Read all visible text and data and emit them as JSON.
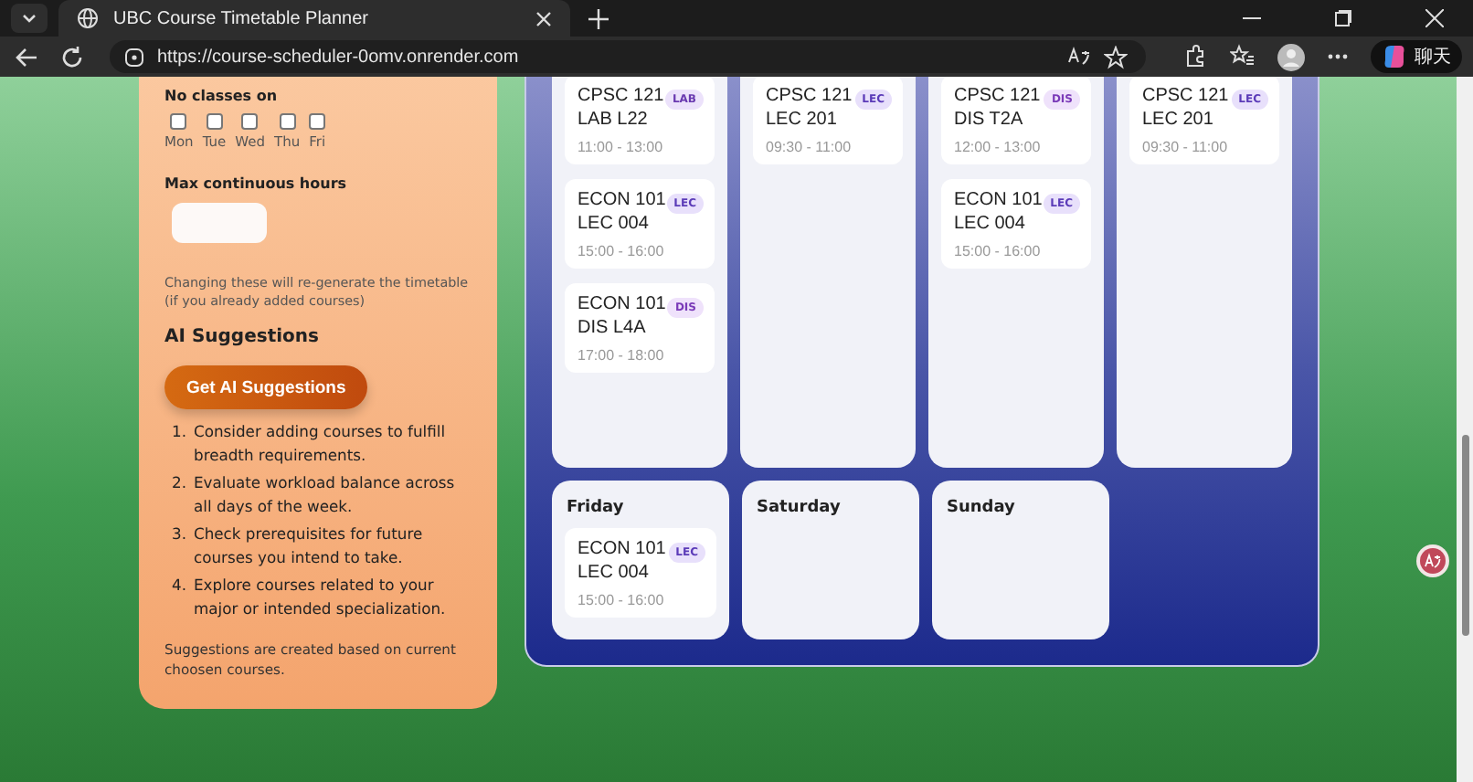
{
  "browser": {
    "tab_title": "UBC Course Timetable Planner",
    "url": "https://course-scheduler-0omv.onrender.com",
    "copilot_label": "聊天"
  },
  "preferences": {
    "no_classes_label": "No classes on",
    "days": [
      {
        "label": "Mon",
        "checked": false
      },
      {
        "label": "Tue",
        "checked": false
      },
      {
        "label": "Wed",
        "checked": false
      },
      {
        "label": "Thu",
        "checked": false
      },
      {
        "label": "Fri",
        "checked": false
      }
    ],
    "max_hours_label": "Max continuous hours",
    "note": "Changing these will re-generate the timetable (if you already added courses)"
  },
  "ai": {
    "title": "AI Suggestions",
    "button": "Get AI Suggestions",
    "suggestions": [
      {
        "number": "1.",
        "text": "Consider adding courses to fulfill breadth requirements."
      },
      {
        "number": "2.",
        "text": "Evaluate workload balance across all days of the week."
      },
      {
        "number": "3.",
        "text": "Check prerequisites for future courses you intend to take."
      },
      {
        "number": "4.",
        "text": "Explore courses related to your major or intended specialization."
      }
    ],
    "footer": "Suggestions are created based on current choosen courses."
  },
  "timetable": {
    "top_days": [
      {
        "classes": [
          {
            "course": "CPSC 121",
            "section": "LAB L22",
            "type": "LAB",
            "time": "11:00 - 13:00"
          },
          {
            "course": "ECON 101",
            "section": "LEC 004",
            "type": "LEC",
            "time": "15:00 - 16:00"
          },
          {
            "course": "ECON 101",
            "section": "DIS L4A",
            "type": "DIS",
            "time": "17:00 - 18:00"
          }
        ]
      },
      {
        "classes": [
          {
            "course": "CPSC 121",
            "section": "LEC 201",
            "type": "LEC",
            "time": "09:30 - 11:00"
          }
        ]
      },
      {
        "classes": [
          {
            "course": "CPSC 121",
            "section": "DIS T2A",
            "type": "DIS",
            "time": "12:00 - 13:00"
          },
          {
            "course": "ECON 101",
            "section": "LEC 004",
            "type": "LEC",
            "time": "15:00 - 16:00"
          }
        ]
      },
      {
        "classes": [
          {
            "course": "CPSC 121",
            "section": "LEC 201",
            "type": "LEC",
            "time": "09:30 - 11:00"
          }
        ]
      }
    ],
    "days": [
      {
        "name": "Friday",
        "classes": [
          {
            "course": "ECON 101",
            "section": "LEC 004",
            "type": "LEC",
            "time": "15:00 - 16:00"
          }
        ]
      },
      {
        "name": "Saturday"
      },
      {
        "name": "Sunday"
      }
    ]
  }
}
